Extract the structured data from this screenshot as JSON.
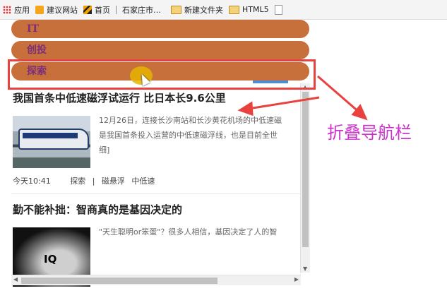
{
  "bookmarks": {
    "apps": "应用",
    "suggested": "建议网站",
    "home": "首页",
    "sjz": "石家庄市…",
    "new_folder": "新建文件夹",
    "html5": "HTML5"
  },
  "nav": {
    "items": [
      {
        "label": "IT"
      },
      {
        "label": "创投"
      },
      {
        "label": "探索"
      }
    ]
  },
  "articles": [
    {
      "title": "我国首条中低速磁浮试运行 比日本长9.6公里",
      "summary_lines": [
        "12月26日，连接长沙南站和长沙黄花机场的中低速磁",
        "是我国首条投入运营的中低速磁浮线，也是目前全世",
        "细]"
      ],
      "time": "今天10:41",
      "tags": [
        "探索",
        "|",
        "磁悬浮",
        "中低速"
      ]
    },
    {
      "title": "勤不能补拙：智商真的是基因决定的",
      "summary_lines": [
        "\"天生聪明or笨蛋\"？很多人相信，基因决定了人的智"
      ],
      "thumb_text": "IQ"
    }
  ],
  "annotation": {
    "text": "折叠导航栏",
    "color": "#cc33cc"
  },
  "colors": {
    "nav_bg": "#c8703c",
    "nav_text": "#7b2e7a",
    "highlight": "#e8413e"
  }
}
